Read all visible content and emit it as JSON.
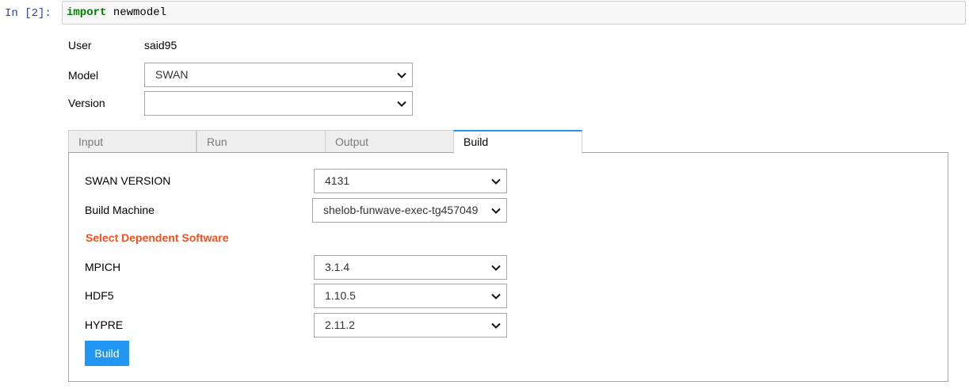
{
  "cell": {
    "prompt": "In [2]:",
    "keyword": "import",
    "rest": " newmodel"
  },
  "form": {
    "user_label": "User",
    "user_value": "said95",
    "model_label": "Model",
    "model_value": "SWAN",
    "version_label": "Version",
    "version_value": ""
  },
  "tabs": [
    {
      "label": "Input"
    },
    {
      "label": "Run"
    },
    {
      "label": "Output"
    },
    {
      "label": "Build"
    }
  ],
  "build": {
    "swan_version_label": "SWAN VERSION",
    "swan_version_value": "4131",
    "machine_label": "Build Machine",
    "machine_value": "shelob-funwave-exec-tg457049",
    "section_title": "Select Dependent Software",
    "mpich_label": "MPICH",
    "mpich_value": "3.1.4",
    "hdf5_label": "HDF5",
    "hdf5_value": "1.10.5",
    "hypre_label": "HYPRE",
    "hypre_value": "2.11.2",
    "button_label": "Build"
  },
  "colors": {
    "accent": "#2196f3",
    "section_title": "#f4511e",
    "keyword": "#008000",
    "prompt": "#303f9f"
  },
  "icons": {
    "dropdown": "chevron-down-icon"
  }
}
